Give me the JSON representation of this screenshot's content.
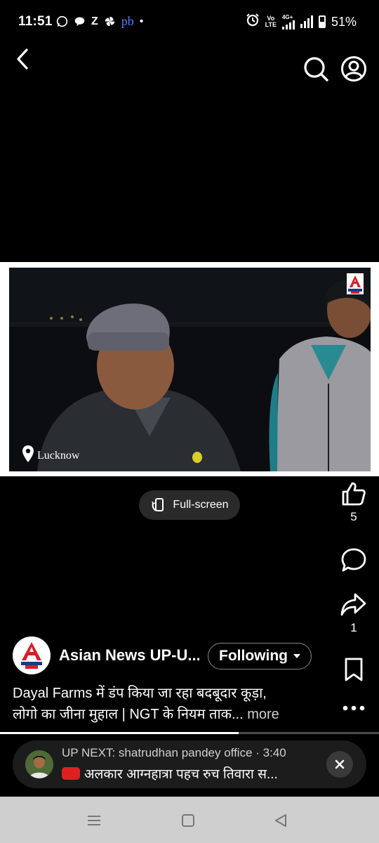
{
  "status_bar": {
    "time": "11:51",
    "notif_z": "Z",
    "notif_pb": "pb",
    "dot": "•",
    "network_top": "Vo",
    "network_bottom": "LTE",
    "net_type": "4G+",
    "battery": "51%"
  },
  "video": {
    "location": "Lucknow"
  },
  "fullscreen": {
    "label": "Full-screen"
  },
  "actions": {
    "like_count": "5",
    "share_count": "1"
  },
  "channel": {
    "name": "Asian News UP-U...",
    "follow_label": "Following"
  },
  "title": {
    "line1": "Dayal Farms में डंप किया जा रहा बदबूदार कूड़ा,",
    "line2": "लोगो का जीना मुहाल | NGT के नियम ताक...",
    "more": "more"
  },
  "progress": {
    "fraction": 0.63
  },
  "up_next": {
    "line1": "UP NEXT: shatrudhan pandey office · 3:40",
    "line2": "अलकार आग्नहात्रा पहच रुच तिवारा स..."
  },
  "colors": {
    "background": "#000000",
    "pill": "#2a2a2a",
    "upnext_bg": "#1c1c1c",
    "brand_red": "#e02020",
    "nav_bar": "#cfcfcf"
  }
}
